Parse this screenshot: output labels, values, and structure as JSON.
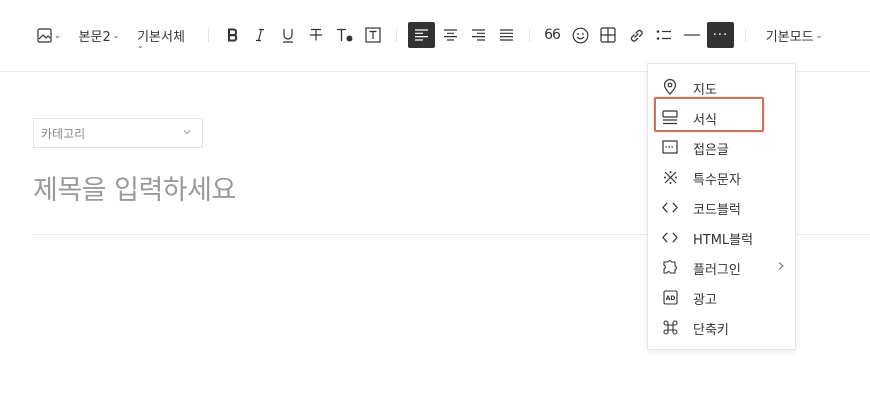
{
  "toolbar": {
    "paragraph_style": "본문2",
    "font_family": "기본서체",
    "quote_glyph": "66",
    "more_glyph": "···",
    "mode": "기본모드"
  },
  "editor": {
    "category_placeholder": "카테고리",
    "title_placeholder": "제목을 입력하세요"
  },
  "more_menu": {
    "items": [
      {
        "label": "지도",
        "icon": "map-pin-icon"
      },
      {
        "label": "서식",
        "icon": "template-icon"
      },
      {
        "label": "접은글",
        "icon": "fold-icon"
      },
      {
        "label": "특수문자",
        "icon": "special-char-icon"
      },
      {
        "label": "코드블럭",
        "icon": "code-icon"
      },
      {
        "label": "HTML블럭",
        "icon": "html-icon"
      },
      {
        "label": "플러그인",
        "icon": "plugin-icon"
      },
      {
        "label": "광고",
        "icon": "ad-icon"
      },
      {
        "label": "단축키",
        "icon": "command-icon"
      }
    ],
    "selected": "서식",
    "ad_icon_text": "AD"
  },
  "colors": {
    "active_button": "#333333",
    "highlight_border": "#c8735a",
    "placeholder_text": "#9a9a9a"
  }
}
